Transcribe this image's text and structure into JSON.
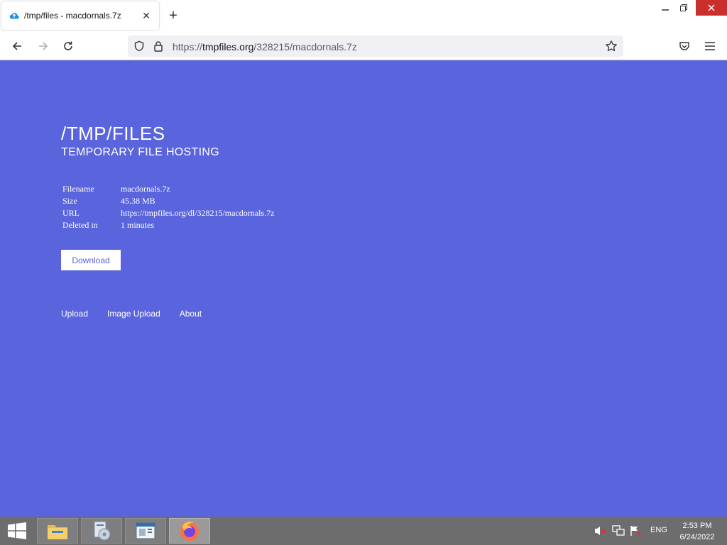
{
  "browser": {
    "tab": {
      "title": "/tmp/files - macdornals.7z",
      "close": "✕"
    },
    "new_tab": "+",
    "window_controls": {
      "minimize": "—",
      "maximize": "❐",
      "close": "✕"
    },
    "url": {
      "prefix": "https://",
      "domain": "tmpfiles.org",
      "path": "/328215/macdornals.7z"
    }
  },
  "page": {
    "title": "/TMP/FILES",
    "subtitle": "TEMPORARY FILE HOSTING",
    "info": [
      {
        "key": "Filename",
        "value": "macdornals.7z"
      },
      {
        "key": "Size",
        "value": "45.38 MB"
      },
      {
        "key": "URL",
        "value": "https://tmpfiles.org/dl/328215/macdornals.7z"
      },
      {
        "key": "Deleted in",
        "value": "1 minutes"
      }
    ],
    "download_label": "Download",
    "footer_links": [
      "Upload",
      "Image Upload",
      "About"
    ],
    "background_color": "#5a64dc"
  },
  "taskbar": {
    "apps": [
      "file-explorer-icon",
      "installer-icon",
      "server-manager-icon",
      "firefox-icon"
    ],
    "language": "ENG",
    "time": "2:53 PM",
    "date": "6/24/2022"
  }
}
